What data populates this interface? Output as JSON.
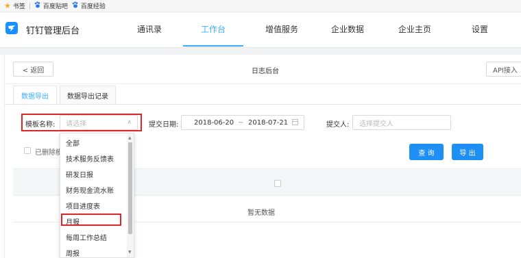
{
  "bookmarks": [
    {
      "label": "书签",
      "icon": "star-icon"
    },
    {
      "label": "百度贴吧",
      "icon": "baidu-paw-icon"
    },
    {
      "label": "百度经验",
      "icon": "baidu-paw-icon"
    }
  ],
  "app": {
    "title": "钉钉管理后台",
    "logo_icon": "dingtalk-logo-icon"
  },
  "nav": {
    "items": [
      {
        "label": "通讯录"
      },
      {
        "label": "工作台",
        "active": true
      },
      {
        "label": "增值服务"
      },
      {
        "label": "企业数据"
      },
      {
        "label": "企业主页"
      },
      {
        "label": "设置"
      }
    ]
  },
  "header": {
    "back_label": "< 返回",
    "page_title": "日志后台",
    "api_label": "API接入"
  },
  "tabs": [
    {
      "label": "数据导出",
      "active": true
    },
    {
      "label": "数据导出记录"
    }
  ],
  "filters": {
    "template_label": "模板名称:",
    "template_placeholder": "请选择",
    "date_label": "提交日期:",
    "date_start": "2018-06-20",
    "date_sep": "~",
    "date_end": "2018-07-21",
    "submitter_label": "提交人:",
    "submitter_placeholder": "选择提交人",
    "deleted_label": "已删除模"
  },
  "buttons": {
    "query": "查 询",
    "export": "导 出"
  },
  "table": {
    "empty_text": "暂无数据"
  },
  "dropdown": {
    "options": [
      "全部",
      "技术服务反馈表",
      "研发日报",
      "财务现金流水账",
      "项目进度表",
      "月报",
      "每周工作总结",
      "周报"
    ],
    "highlighted": "月报"
  },
  "colors": {
    "accent": "#38adff",
    "button_blue": "#1e90f5",
    "highlight_red": "#e02424"
  }
}
